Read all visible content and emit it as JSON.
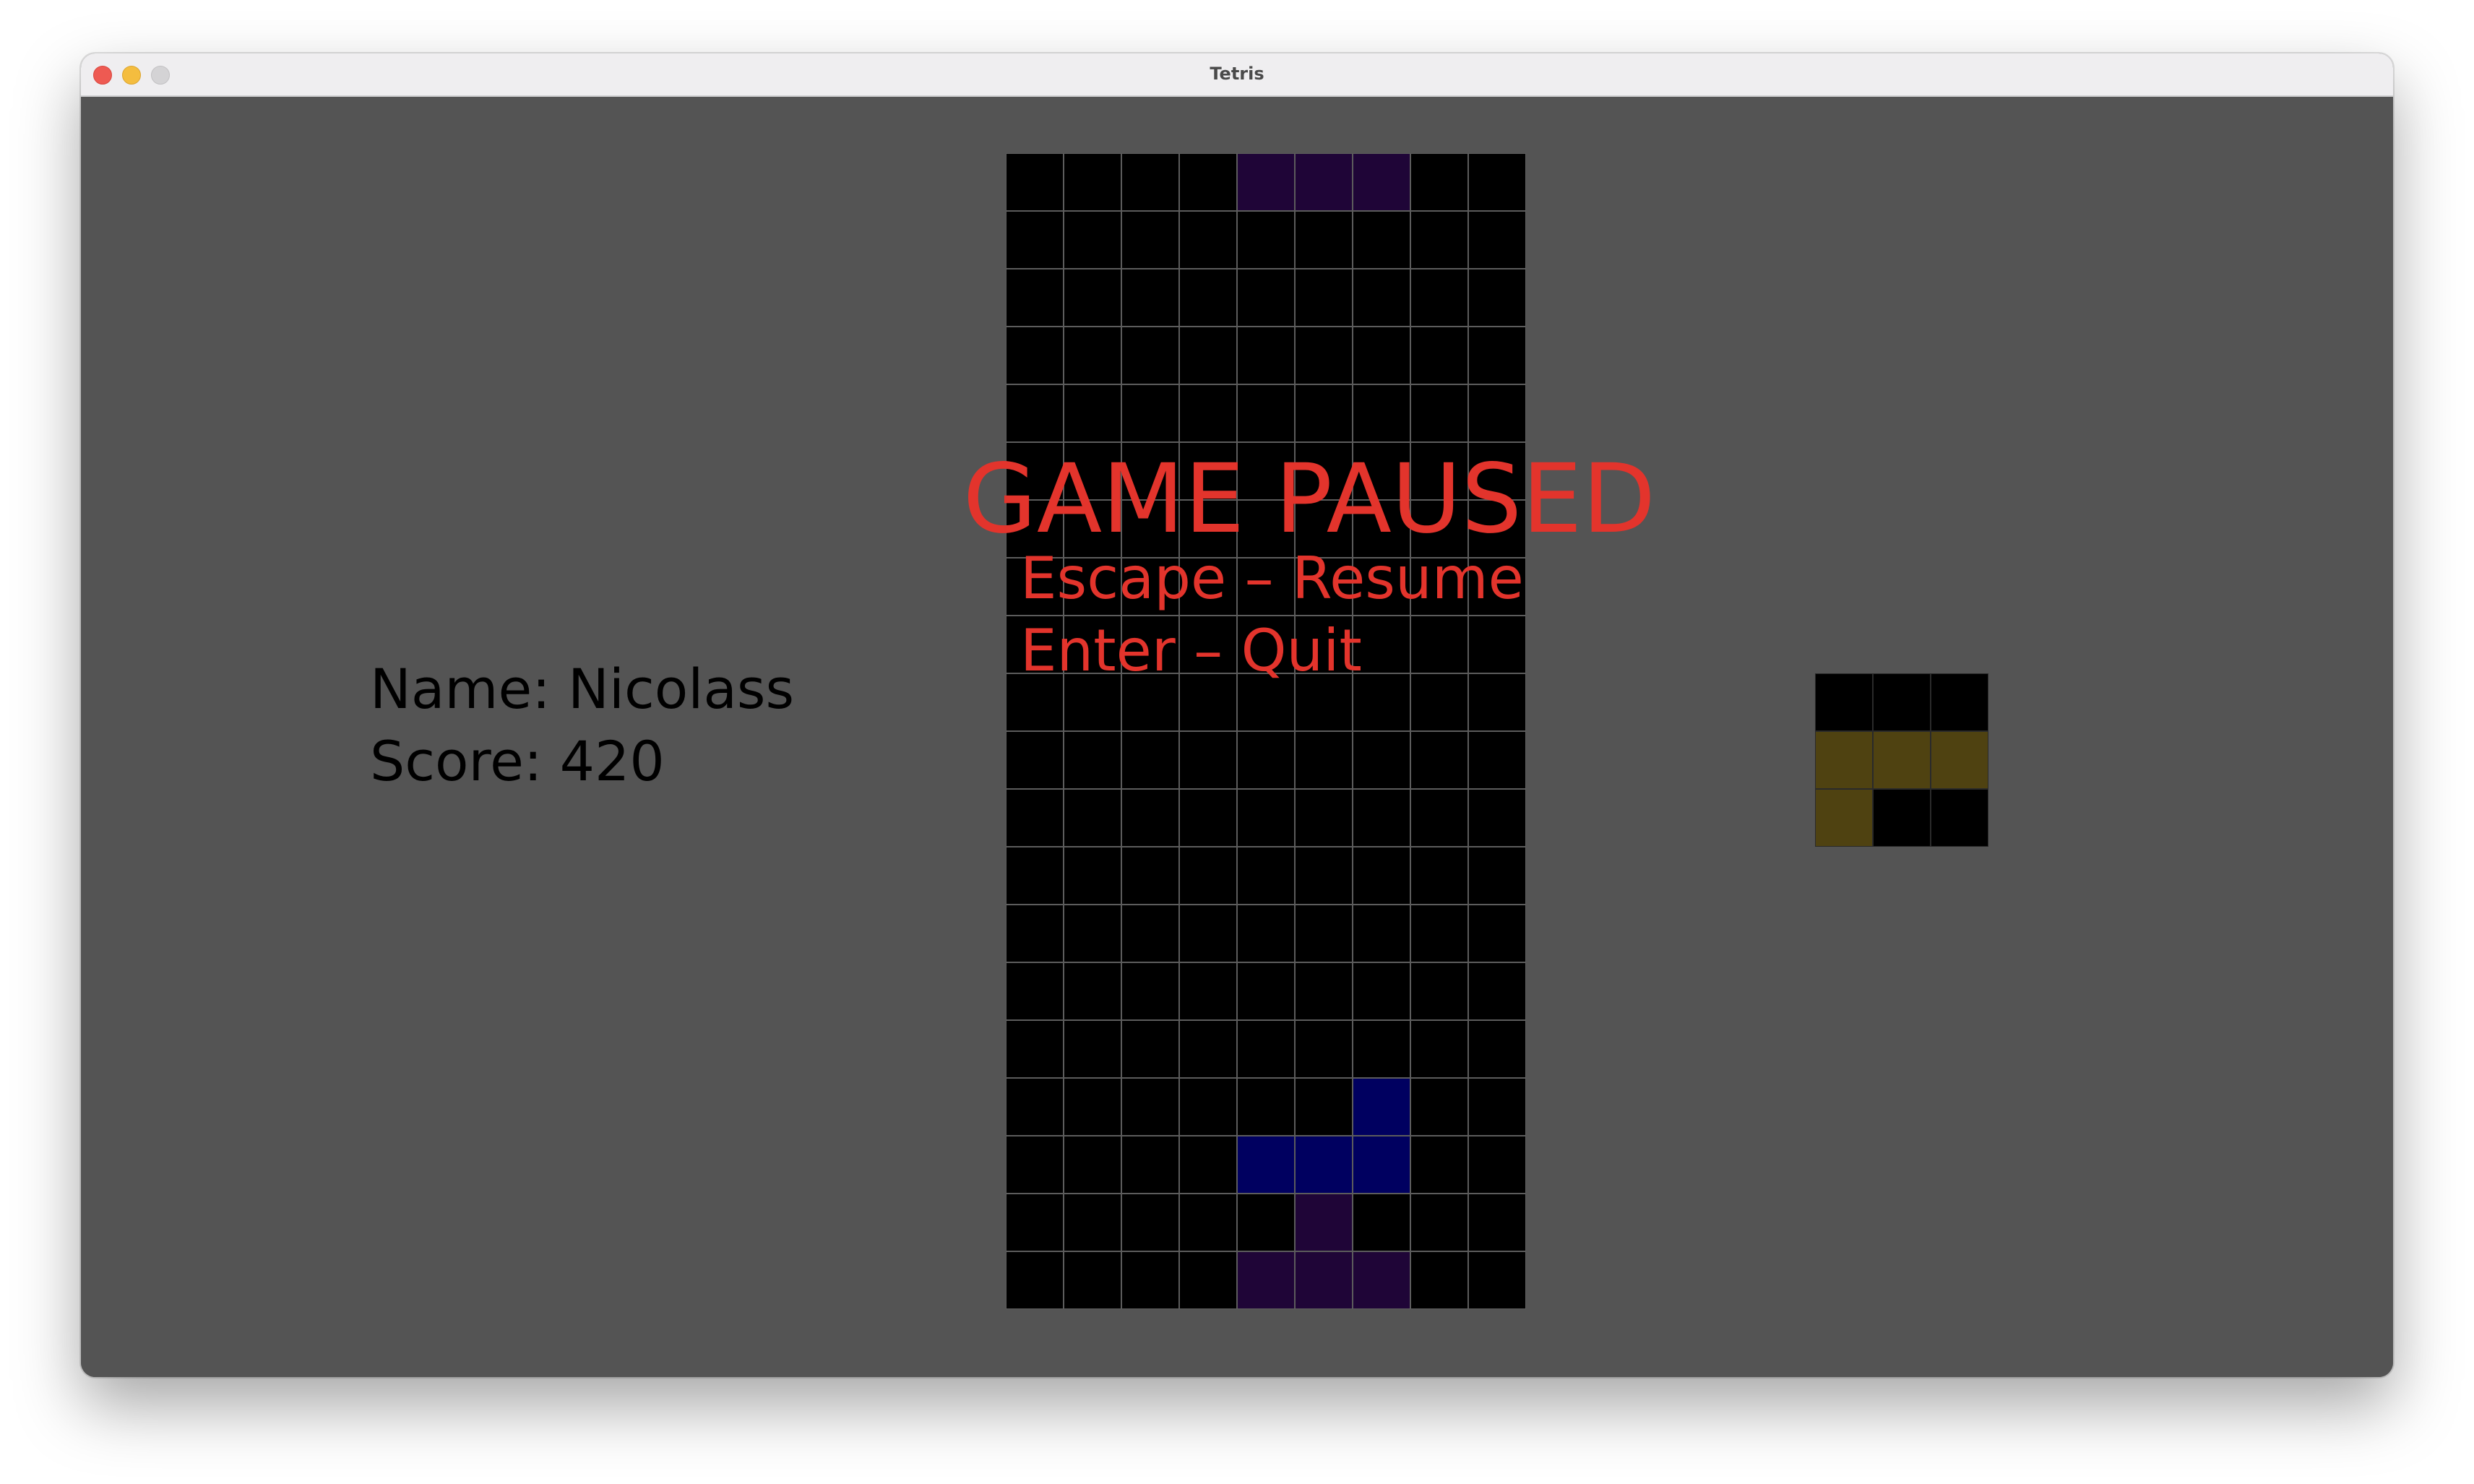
{
  "window": {
    "title": "Tetris"
  },
  "player": {
    "name_text": "Name: Nicolass",
    "score_text": "Score: 420",
    "name": "Nicolass",
    "score": 420
  },
  "pause_menu": {
    "title": "GAME PAUSED",
    "resume_text": "Escape – Resume",
    "quit_text": "Enter – Quit"
  },
  "colors": {
    "background": "#545454",
    "board_empty": "#000000",
    "grid_line": "#5c5c5c",
    "pause_text": "#e3342c",
    "T": "#1f0537",
    "J": "#000060",
    "L": "#4f4211"
  },
  "board": {
    "columns": 9,
    "rows": 20,
    "filled_cells": [
      {
        "row": 0,
        "col": 4,
        "piece": "T"
      },
      {
        "row": 0,
        "col": 5,
        "piece": "T"
      },
      {
        "row": 0,
        "col": 6,
        "piece": "T"
      },
      {
        "row": 16,
        "col": 6,
        "piece": "J"
      },
      {
        "row": 17,
        "col": 4,
        "piece": "J"
      },
      {
        "row": 17,
        "col": 5,
        "piece": "J"
      },
      {
        "row": 17,
        "col": 6,
        "piece": "J"
      },
      {
        "row": 18,
        "col": 5,
        "piece": "T"
      },
      {
        "row": 19,
        "col": 4,
        "piece": "T"
      },
      {
        "row": 19,
        "col": 5,
        "piece": "T"
      },
      {
        "row": 19,
        "col": 6,
        "piece": "T"
      }
    ]
  },
  "next_piece": {
    "type": "L",
    "columns": 3,
    "rows": 3,
    "filled_cells": [
      {
        "row": 1,
        "col": 0
      },
      {
        "row": 1,
        "col": 1
      },
      {
        "row": 1,
        "col": 2
      },
      {
        "row": 2,
        "col": 0
      }
    ]
  }
}
